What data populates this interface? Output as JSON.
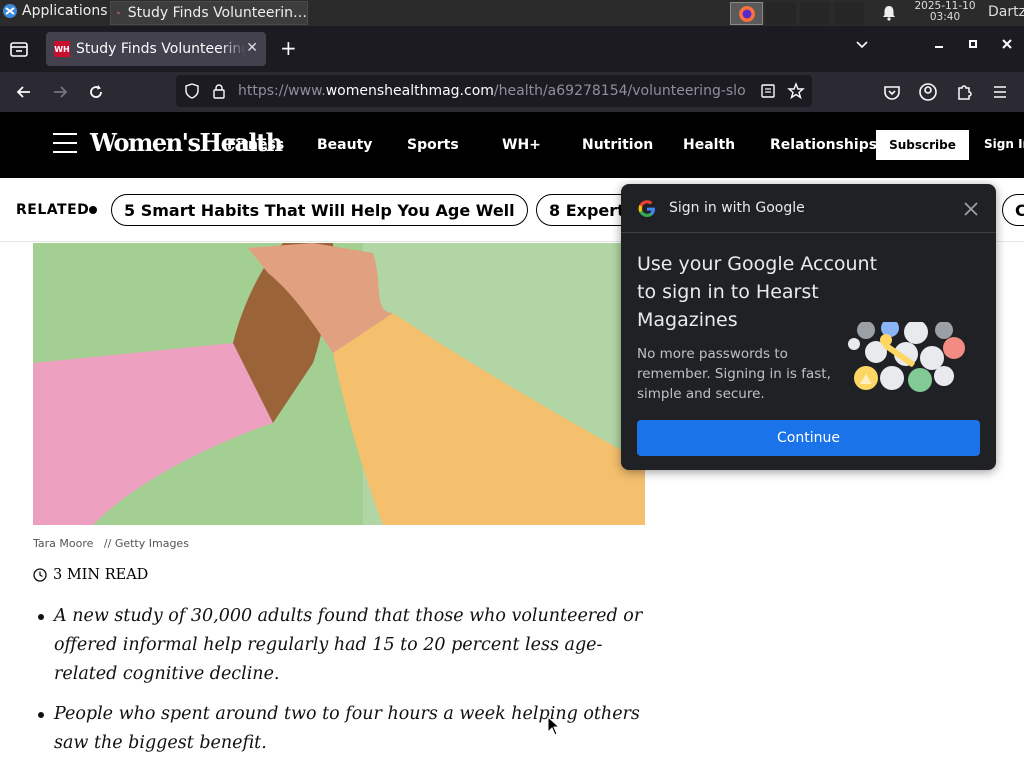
{
  "taskbar": {
    "applications_label": "Applications",
    "task_title": "Study Finds Volunteerin…",
    "clock_date": "2025-11-10",
    "clock_time": "03:40",
    "user": "Dartz"
  },
  "browser": {
    "tab_title": "Study Finds Volunteering",
    "tab_favicon_text": "WH",
    "url_prefix": "https://www.",
    "url_host": "womenshealthmag.com",
    "url_path": "/health/a69278154/volunteering-slo"
  },
  "site": {
    "brand": "Women'sHealth",
    "menu": [
      "Fitness",
      "Beauty",
      "Sports",
      "WH+",
      "Nutrition",
      "Health",
      "Relationships"
    ],
    "subscribe": "Subscribe",
    "signin": "Sign In"
  },
  "related": {
    "label": "RELATED",
    "items": [
      "5 Smart Habits That Will Help You Age Well",
      "8 Expert",
      "C"
    ]
  },
  "article": {
    "photo_credit": "Tara Moore",
    "photo_source": "//  Getty Images",
    "read_time": "3 MIN READ",
    "bullets": [
      "A new study of 30,000 adults found that those who volunteered or offered informal help regularly had 15 to 20 percent less age-related cognitive decline.",
      "People who spent around two to four hours a week helping others saw the biggest benefit."
    ]
  },
  "google_popup": {
    "header": "Sign in with Google",
    "title": "Use your Google Account to sign in to Hearst Magazines",
    "description": "No more passwords to remember. Signing in is fast, simple and secure.",
    "continue_label": "Continue"
  },
  "colors": {
    "site_header_bg": "#000000",
    "popup_bg": "#202124",
    "continue_blue": "#1a73e8",
    "browser_chrome": "#2b2a33"
  }
}
